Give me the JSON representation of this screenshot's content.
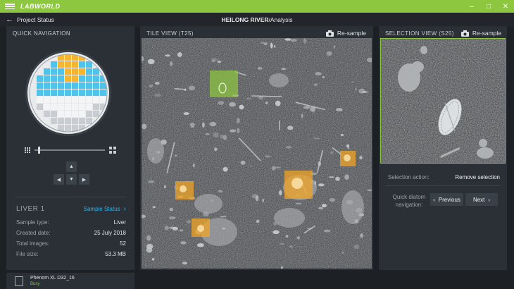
{
  "titlebar": {
    "brand": "LABWORLD",
    "controls": {
      "minimize": "–",
      "maximize": "□",
      "close": "✕"
    },
    "accent": "#8dc63f"
  },
  "header": {
    "back_label": "Project Status",
    "crumb_strong": "HEILONG RIVER",
    "crumb_rest": "/Analysis"
  },
  "left_panel": {
    "title": "QUICK NAVIGATION",
    "zoom_slider_level": 0.05,
    "sample": {
      "name": "LIVER 1",
      "status_link": "Sample Status",
      "rows": [
        {
          "key": "Sample type:",
          "value": "Liver"
        },
        {
          "key": "Created date:",
          "value": "25 July 2018"
        },
        {
          "key": "Total images:",
          "value": "52"
        },
        {
          "key": "File size:",
          "value": "53.3 MB"
        }
      ]
    }
  },
  "device": {
    "name": "Phenom XL D32_16",
    "status": "Busy"
  },
  "tile_view": {
    "title": "TILE VIEW (T25)",
    "resample_label": "Re-sample",
    "highlight_colors": {
      "selected": "#8dc63f",
      "candidate": "#f5a623"
    }
  },
  "selection_view": {
    "title": "SELECTION VIEW (S25)",
    "resample_label": "Re-sample",
    "action_label": "Selection action:",
    "action_value": "Remove selection",
    "quick_nav_label": "Quick diatom navigation:",
    "prev_label": "Previous",
    "next_label": "Next"
  },
  "colors": {
    "link": "#35b5e8",
    "panel": "#2b3036",
    "background": "#1d2126"
  }
}
